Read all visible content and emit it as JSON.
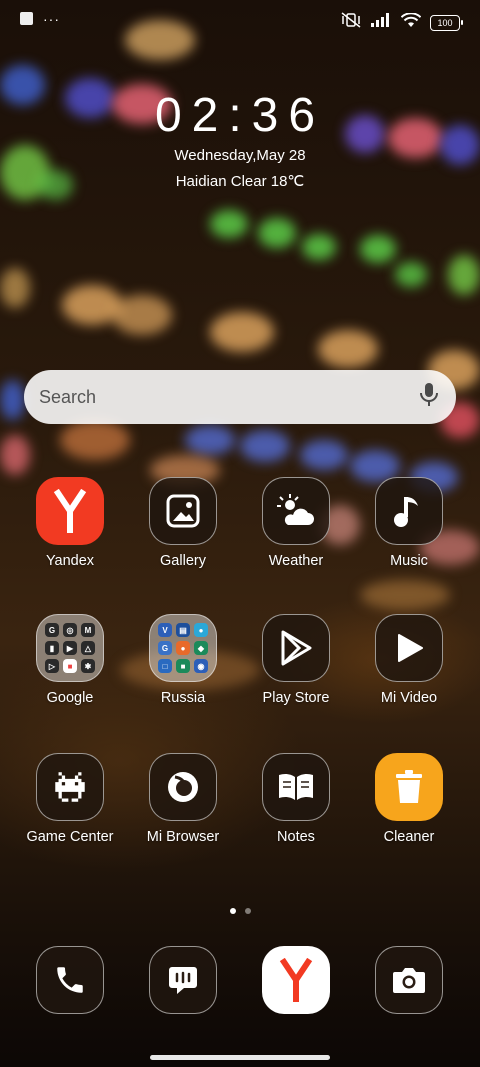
{
  "status_bar": {
    "icons": [
      "notification-square-icon",
      "more-notifications-icon",
      "vibrate-off-icon",
      "signal-icon",
      "wifi-icon",
      "battery-icon"
    ],
    "battery_level": "100",
    "more_indicator": "···"
  },
  "lockclock": {
    "time": "02:36",
    "date": "Wednesday,May 28",
    "weather": "Haidian Clear 18℃"
  },
  "search": {
    "placeholder": "Search"
  },
  "apps": [
    {
      "label": "Yandex"
    },
    {
      "label": "Gallery"
    },
    {
      "label": "Weather"
    },
    {
      "label": "Music"
    },
    {
      "label": "Google"
    },
    {
      "label": "Russia"
    },
    {
      "label": "Play Store"
    },
    {
      "label": "Mi Video"
    },
    {
      "label": "Game Center"
    },
    {
      "label": "Mi Browser"
    },
    {
      "label": "Notes"
    },
    {
      "label": "Cleaner"
    }
  ],
  "page_indicator": {
    "pages": 2,
    "current": 1
  },
  "dock": [
    {
      "icon": "phone-icon"
    },
    {
      "icon": "messages-icon"
    },
    {
      "icon": "yandex-browser-icon"
    },
    {
      "icon": "camera-icon"
    }
  ],
  "colors": {
    "yandex_red": "#f23a22",
    "cleaner_yellow": "#f7a51c",
    "search_bg": "#f2f0ee"
  }
}
